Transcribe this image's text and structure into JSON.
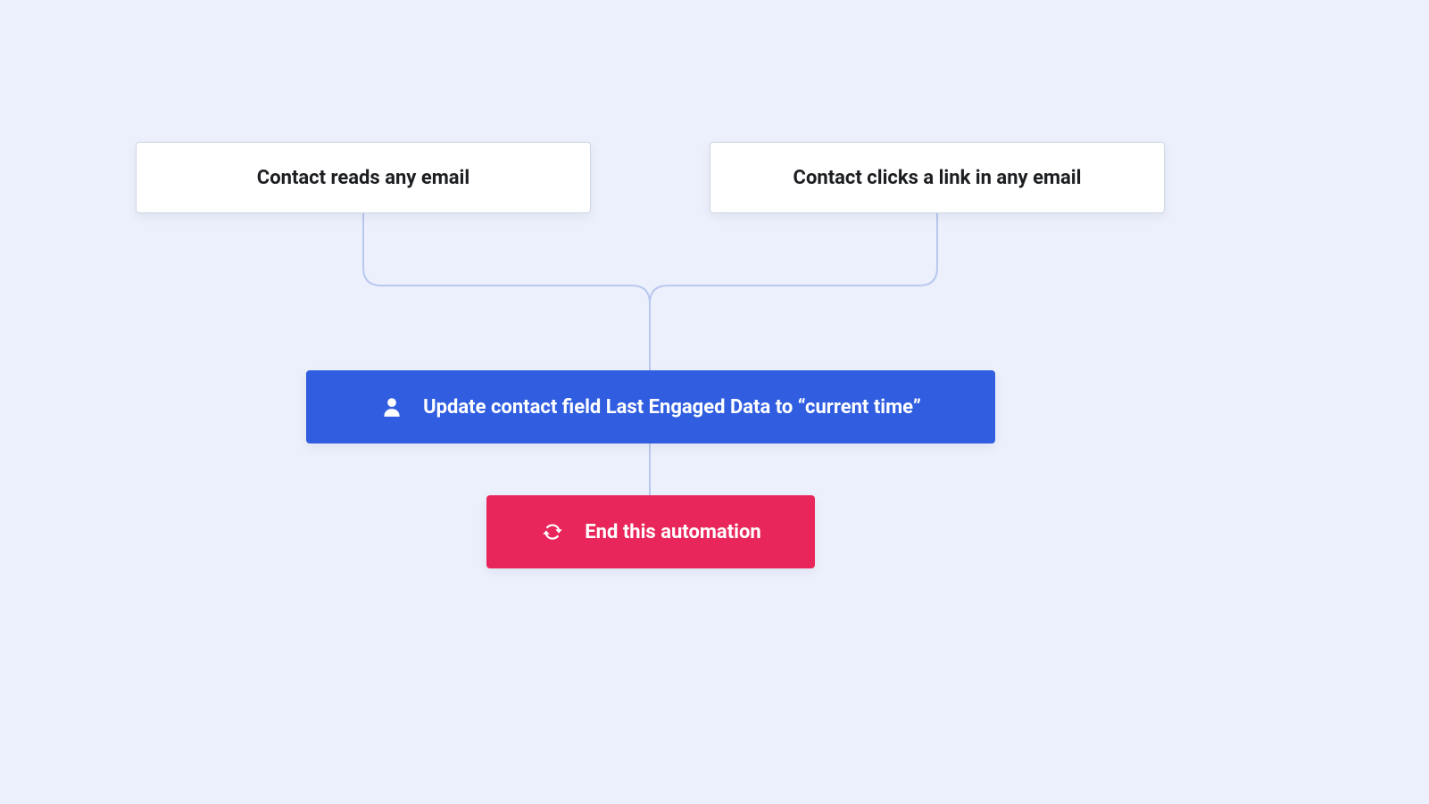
{
  "triggers": {
    "left": "Contact reads any email",
    "right": "Contact clicks a link in any email"
  },
  "action_update": "Update contact field Last Engaged Data to “current time”",
  "action_end": "End this automation"
}
